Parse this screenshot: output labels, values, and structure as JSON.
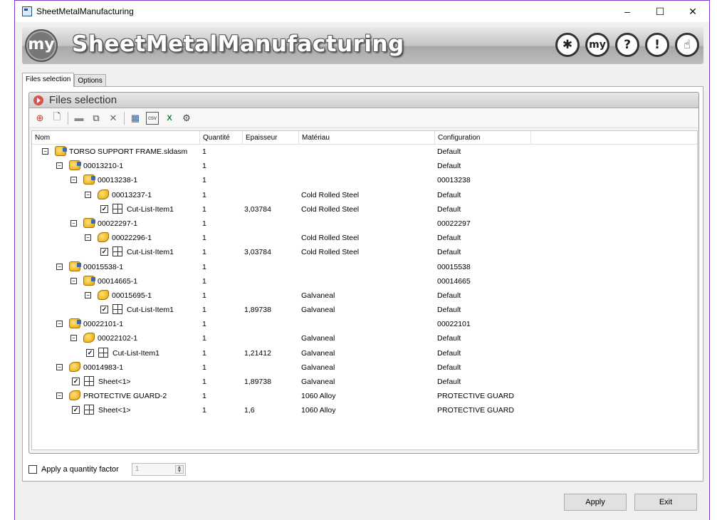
{
  "window": {
    "title": "SheetMetalManufacturing",
    "controls": {
      "minimize": "–",
      "maximize": "☐",
      "close": "✕"
    }
  },
  "banner": {
    "logo_text": "my",
    "title": "SheetMetalManufacturing",
    "buttons": [
      {
        "name": "whats-new-button",
        "label": "✱"
      },
      {
        "name": "my-button",
        "label": "my"
      },
      {
        "name": "help-button",
        "label": "?"
      },
      {
        "name": "info-button",
        "label": "!"
      },
      {
        "name": "support-button",
        "label": "☝"
      }
    ]
  },
  "tabs": [
    {
      "label": "Files selection",
      "active": true
    },
    {
      "label": "Options",
      "active": false
    }
  ],
  "group": {
    "title": "Files selection"
  },
  "toolbar": {
    "icons": [
      "add-assembly-icon",
      "add-file-icon",
      "folder-icon",
      "copy-icon",
      "delete-icon",
      "table-icon",
      "csv-icon",
      "excel-icon",
      "settings-icon"
    ]
  },
  "columns": [
    "Nom",
    "Quantité",
    "Epaisseur",
    "Matériau",
    "Configuration"
  ],
  "rows": [
    {
      "level": 0,
      "toggle": "⊟",
      "icon": "asm",
      "check": false,
      "name": "TORSO SUPPORT FRAME.sldasm",
      "qty": "1",
      "thick": "",
      "mat": "",
      "config": "Default"
    },
    {
      "level": 1,
      "toggle": "⊟",
      "icon": "asm",
      "check": false,
      "name": "00013210-1",
      "qty": "1",
      "thick": "",
      "mat": "",
      "config": "Default"
    },
    {
      "level": 2,
      "toggle": "⊟",
      "icon": "asm",
      "check": false,
      "name": "00013238-1",
      "qty": "1",
      "thick": "",
      "mat": "",
      "config": "00013238"
    },
    {
      "level": 3,
      "toggle": "⊟",
      "icon": "part",
      "check": false,
      "name": "00013237-1",
      "qty": "1",
      "thick": "",
      "mat": "Cold Rolled Steel",
      "config": "Default"
    },
    {
      "level": 4,
      "toggle": "",
      "icon": "cut",
      "check": true,
      "name": "Cut-List-Item1",
      "qty": "1",
      "thick": "3,03784",
      "mat": "Cold Rolled Steel",
      "config": "Default"
    },
    {
      "level": 2,
      "toggle": "⊟",
      "icon": "asm",
      "check": false,
      "name": "00022297-1",
      "qty": "1",
      "thick": "",
      "mat": "",
      "config": "00022297"
    },
    {
      "level": 3,
      "toggle": "⊟",
      "icon": "part",
      "check": false,
      "name": "00022296-1",
      "qty": "1",
      "thick": "",
      "mat": "Cold Rolled Steel",
      "config": "Default"
    },
    {
      "level": 4,
      "toggle": "",
      "icon": "cut",
      "check": true,
      "name": "Cut-List-Item1",
      "qty": "1",
      "thick": "3,03784",
      "mat": "Cold Rolled Steel",
      "config": "Default"
    },
    {
      "level": 1,
      "toggle": "⊟",
      "icon": "asm",
      "check": false,
      "name": "00015538-1",
      "qty": "1",
      "thick": "",
      "mat": "",
      "config": "00015538"
    },
    {
      "level": 2,
      "toggle": "⊟",
      "icon": "asm",
      "check": false,
      "name": "00014665-1",
      "qty": "1",
      "thick": "",
      "mat": "",
      "config": "00014665"
    },
    {
      "level": 3,
      "toggle": "⊟",
      "icon": "part",
      "check": false,
      "name": "00015695-1",
      "qty": "1",
      "thick": "",
      "mat": "Galvaneal",
      "config": "Default"
    },
    {
      "level": 4,
      "toggle": "",
      "icon": "cut",
      "check": true,
      "name": "Cut-List-Item1",
      "qty": "1",
      "thick": "1,89738",
      "mat": "Galvaneal",
      "config": "Default"
    },
    {
      "level": 1,
      "toggle": "⊟",
      "icon": "asm",
      "check": false,
      "name": "00022101-1",
      "qty": "1",
      "thick": "",
      "mat": "",
      "config": "00022101"
    },
    {
      "level": 2,
      "toggle": "⊟",
      "icon": "part",
      "check": false,
      "name": "00022102-1",
      "qty": "1",
      "thick": "",
      "mat": "Galvaneal",
      "config": "Default"
    },
    {
      "level": 3,
      "toggle": "",
      "icon": "cut",
      "check": true,
      "name": "Cut-List-Item1",
      "qty": "1",
      "thick": "1,21412",
      "mat": "Galvaneal",
      "config": "Default"
    },
    {
      "level": 1,
      "toggle": "⊟",
      "icon": "part",
      "check": false,
      "name": "00014983-1",
      "qty": "1",
      "thick": "",
      "mat": "Galvaneal",
      "config": "Default"
    },
    {
      "level": 2,
      "toggle": "",
      "icon": "cut",
      "check": true,
      "name": "Sheet<1>",
      "qty": "1",
      "thick": "1,89738",
      "mat": "Galvaneal",
      "config": "Default"
    },
    {
      "level": 1,
      "toggle": "⊟",
      "icon": "part",
      "check": false,
      "name": "PROTECTIVE GUARD-2",
      "qty": "1",
      "thick": "",
      "mat": "1060 Alloy",
      "config": "PROTECTIVE GUARD"
    },
    {
      "level": 2,
      "toggle": "",
      "icon": "cut",
      "check": true,
      "name": "Sheet<1>",
      "qty": "1",
      "thick": "1,6",
      "mat": "1060 Alloy",
      "config": "PROTECTIVE GUARD"
    }
  ],
  "quantity_factor": {
    "label": "Apply a quantity factor",
    "checked": false,
    "value": "1"
  },
  "footer": {
    "apply_label": "Apply",
    "exit_label": "Exit"
  },
  "colors": {
    "window_border": "#7d3cc8",
    "group_icon": "#d9534f",
    "tree_icon": "#e6a400"
  }
}
